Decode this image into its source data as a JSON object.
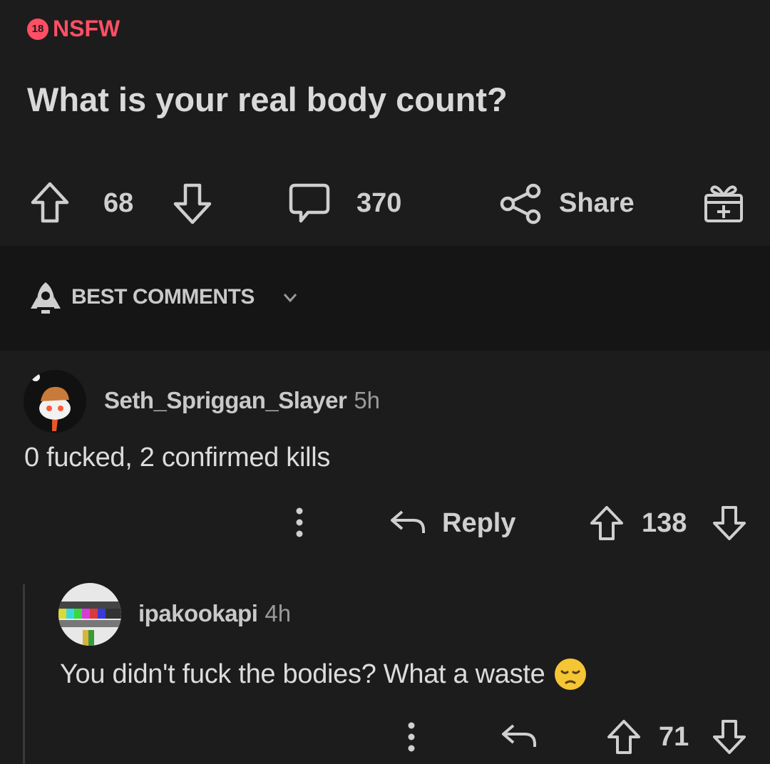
{
  "post": {
    "nsfw_badge": "18",
    "nsfw_label": "NSFW",
    "title": "What is your real body count?",
    "votes": "68",
    "comments": "370",
    "share_label": "Share"
  },
  "sort": {
    "label": "BEST COMMENTS"
  },
  "comments": [
    {
      "username": "Seth_Spriggan_Slayer",
      "age": "5h",
      "text": "0 fucked, 2 confirmed kills",
      "reply_label": "Reply",
      "votes": "138"
    },
    {
      "username": "ipakookapi",
      "age": "4h",
      "text": "You didn't fuck the bodies? What a waste",
      "emoji": "pensive-face",
      "votes": "71"
    }
  ],
  "colors": {
    "background": "#1c1c1c",
    "sort_bar": "#151515",
    "nsfw": "#ff4f64",
    "text": "#d7d7d7"
  }
}
